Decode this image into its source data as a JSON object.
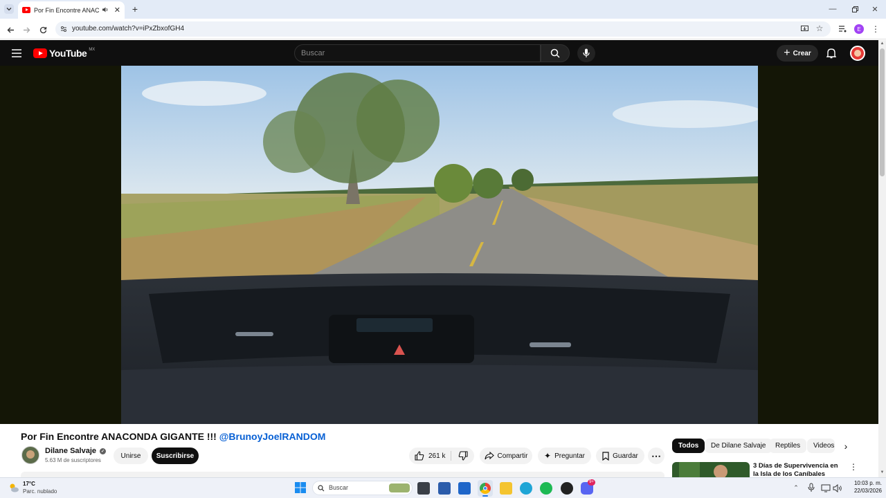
{
  "browser": {
    "tab_title": "Por Fin Encontre ANACONDA GIGANTE !!! @BrunoyJoelRANDOM",
    "url": "youtube.com/watch?v=iPxZbxofGH4",
    "profile_initial": "E"
  },
  "youtube": {
    "logo_text": "YouTube",
    "region": "MX",
    "search_placeholder": "Buscar",
    "create_label": "Crear"
  },
  "video": {
    "title_main": "Por Fin Encontre ANACONDA GIGANTE !!!",
    "title_mention": "@BrunoyJoelRANDOM",
    "channel_name": "Dilane Salvaje",
    "subscribers": "5.63 M de suscriptores",
    "join_label": "Unirse",
    "subscribe_label": "Suscribirse",
    "likes": "261 k",
    "share_label": "Compartir",
    "ask_label": "Preguntar",
    "save_label": "Guardar"
  },
  "sidebar": {
    "chips": [
      "Todos",
      "De Dilane Salvaje",
      "Reptiles",
      "Videos"
    ],
    "first_video_title": "3 Días de Supervivencia en la Isla de los Caníbales"
  },
  "taskbar": {
    "weather_temp": "17°C",
    "weather_desc": "Parc. nublado",
    "search_label": "Buscar",
    "time": "10:03 p. m.",
    "date": "22/03/2026",
    "notification_badge": "9+"
  },
  "colors": {
    "youtube_red": "#ff0000",
    "link_blue": "#065fd4",
    "header_dark": "#0f0f0f"
  }
}
